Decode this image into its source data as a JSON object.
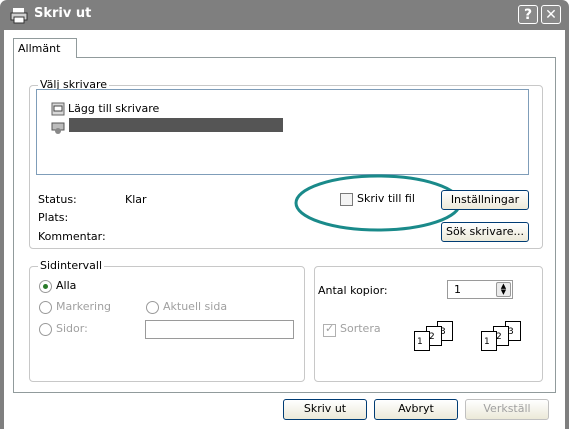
{
  "window": {
    "title": "Skriv ut",
    "help_label": "?",
    "close_label": "✕"
  },
  "tabs": [
    {
      "label": "Allmänt"
    }
  ],
  "printer_group": {
    "legend": "Välj skrivare",
    "items": [
      {
        "label": "Lägg till skrivare",
        "icon": "add-printer-icon"
      },
      {
        "label": "",
        "icon": "printer-icon",
        "redacted": true
      }
    ],
    "status_label": "Status:",
    "status_value": "Klar",
    "location_label": "Plats:",
    "comment_label": "Kommentar:",
    "print_to_file_label": "Skriv till fil",
    "print_to_file_checked": false,
    "settings_button": "Inställningar",
    "find_printer_button": "Sök skrivare..."
  },
  "page_range": {
    "legend": "Sidintervall",
    "all_label": "Alla",
    "selection_label": "Markering",
    "current_page_label": "Aktuell sida",
    "pages_label": "Sidor:",
    "selected": "all"
  },
  "copies": {
    "label": "Antal kopior:",
    "value": "1",
    "collate_label": "Sortera",
    "collate_checked": true,
    "collate_pages_a": [
      "1",
      "2",
      "3"
    ],
    "collate_pages_b": [
      "1",
      "2",
      "3"
    ]
  },
  "footer": {
    "print_button": "Skriv ut",
    "cancel_button": "Avbryt",
    "apply_button": "Verkställ"
  },
  "colors": {
    "highlight_ellipse": "#1a8a8a",
    "titlebar": "#7f7f7f"
  }
}
